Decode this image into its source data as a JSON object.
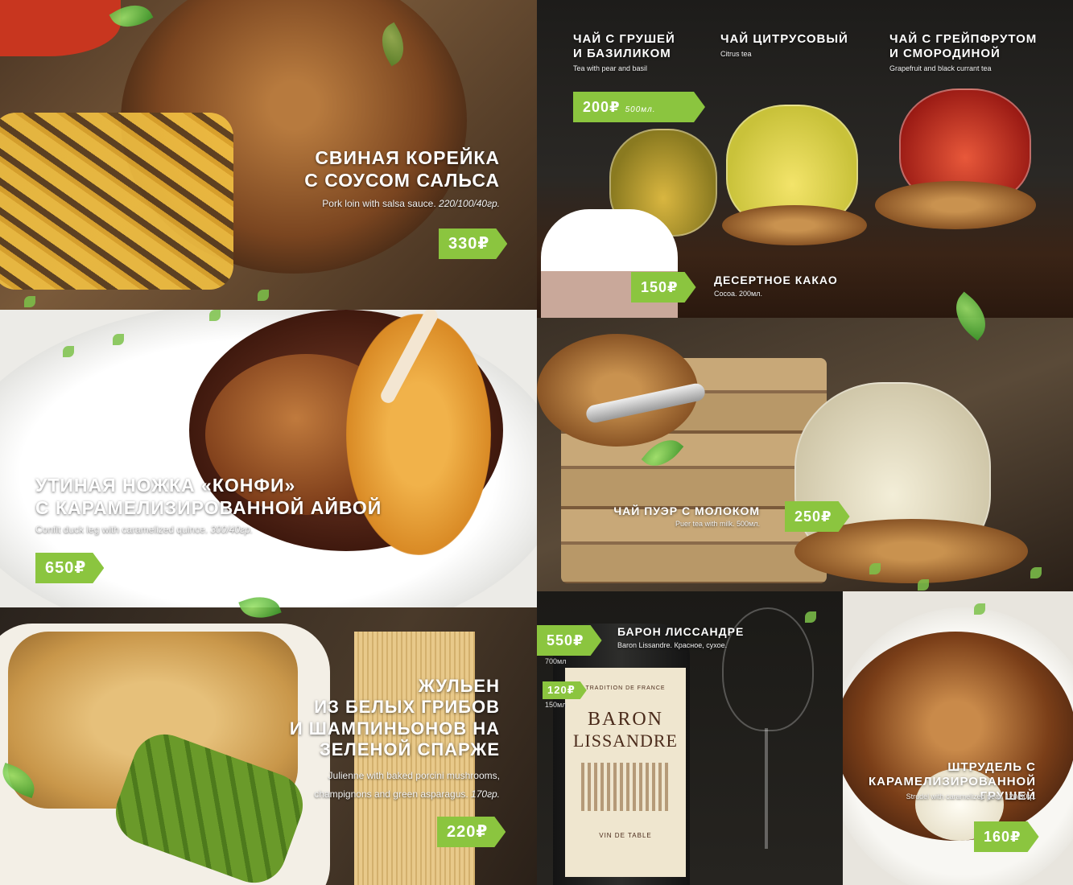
{
  "currency": "₽",
  "dishes": {
    "pork": {
      "title_line1": "СВИНАЯ КОРЕЙКА",
      "title_line2": "С СОУСОМ САЛЬСА",
      "subtitle": "Pork loin with salsa sauce.",
      "weight": "220/100/40гр.",
      "price": "330₽"
    },
    "duck": {
      "title_line1": "УТИНАЯ НОЖКА «КОНФИ»",
      "title_line2": "С КАРАМЕЛИЗИРОВАННОЙ АЙВОЙ",
      "subtitle": "Confit duck leg with caramelized quince.",
      "weight": "300/40гр.",
      "price": "650₽"
    },
    "julienne": {
      "title_line1": "ЖУЛЬЕН",
      "title_line2": "ИЗ БЕЛЫХ ГРИБОВ",
      "title_line3": "И ШАМПИНЬОНОВ НА",
      "title_line4": "ЗЕЛЕНОЙ СПАРЖЕ",
      "subtitle_line1": "Julienne with baked porcini mushrooms,",
      "subtitle_line2": "champignons and green asparagus.",
      "weight": "170гр.",
      "price": "220₽"
    },
    "strudel": {
      "title_line1": "ШТРУДЕЛЬ С",
      "title_line2": "КАРАМЕЛИЗИРОВАННОЙ ГРУШЕЙ",
      "subtitle": "Strudel with caramelized pear. 120/30гр.",
      "price": "160₽"
    }
  },
  "drinks": {
    "tea_pear": {
      "title_line1": "ЧАЙ С ГРУШЕЙ",
      "title_line2": "И БАЗИЛИКОМ",
      "subtitle": "Tea with pear and basil"
    },
    "tea_citrus": {
      "title_line1": "ЧАЙ ЦИТРУСОВЫЙ",
      "subtitle": "Citrus tea"
    },
    "tea_grapefruit": {
      "title_line1": "ЧАЙ С ГРЕЙПФРУТОМ",
      "title_line2": "И СМОРОДИНОЙ",
      "subtitle": "Grapefruit and black currant tea"
    },
    "tea_price": "200₽",
    "tea_volume": "500мл.",
    "cocoa": {
      "title": "ДЕСЕРТНОЕ КАКАО",
      "subtitle": "Cocoa. 200мл.",
      "price": "150₽"
    },
    "puer": {
      "title": "ЧАЙ ПУЭР С МОЛОКОМ",
      "subtitle": "Puer tea with milk. 500мл.",
      "price": "250₽"
    },
    "wine": {
      "title": "БАРОН ЛИССАНДРЕ",
      "subtitle": "Baron Lissandre. Красное, сухое.",
      "price_bottle": "550₽",
      "volume_bottle": "700мл",
      "price_glass": "120₽",
      "volume_glass": "150мл",
      "label_line1": "BARON",
      "label_line2": "LISSANDRE",
      "label_top": "TRADITION DE FRANCE",
      "label_bottom": "VIN DE TABLE"
    }
  }
}
